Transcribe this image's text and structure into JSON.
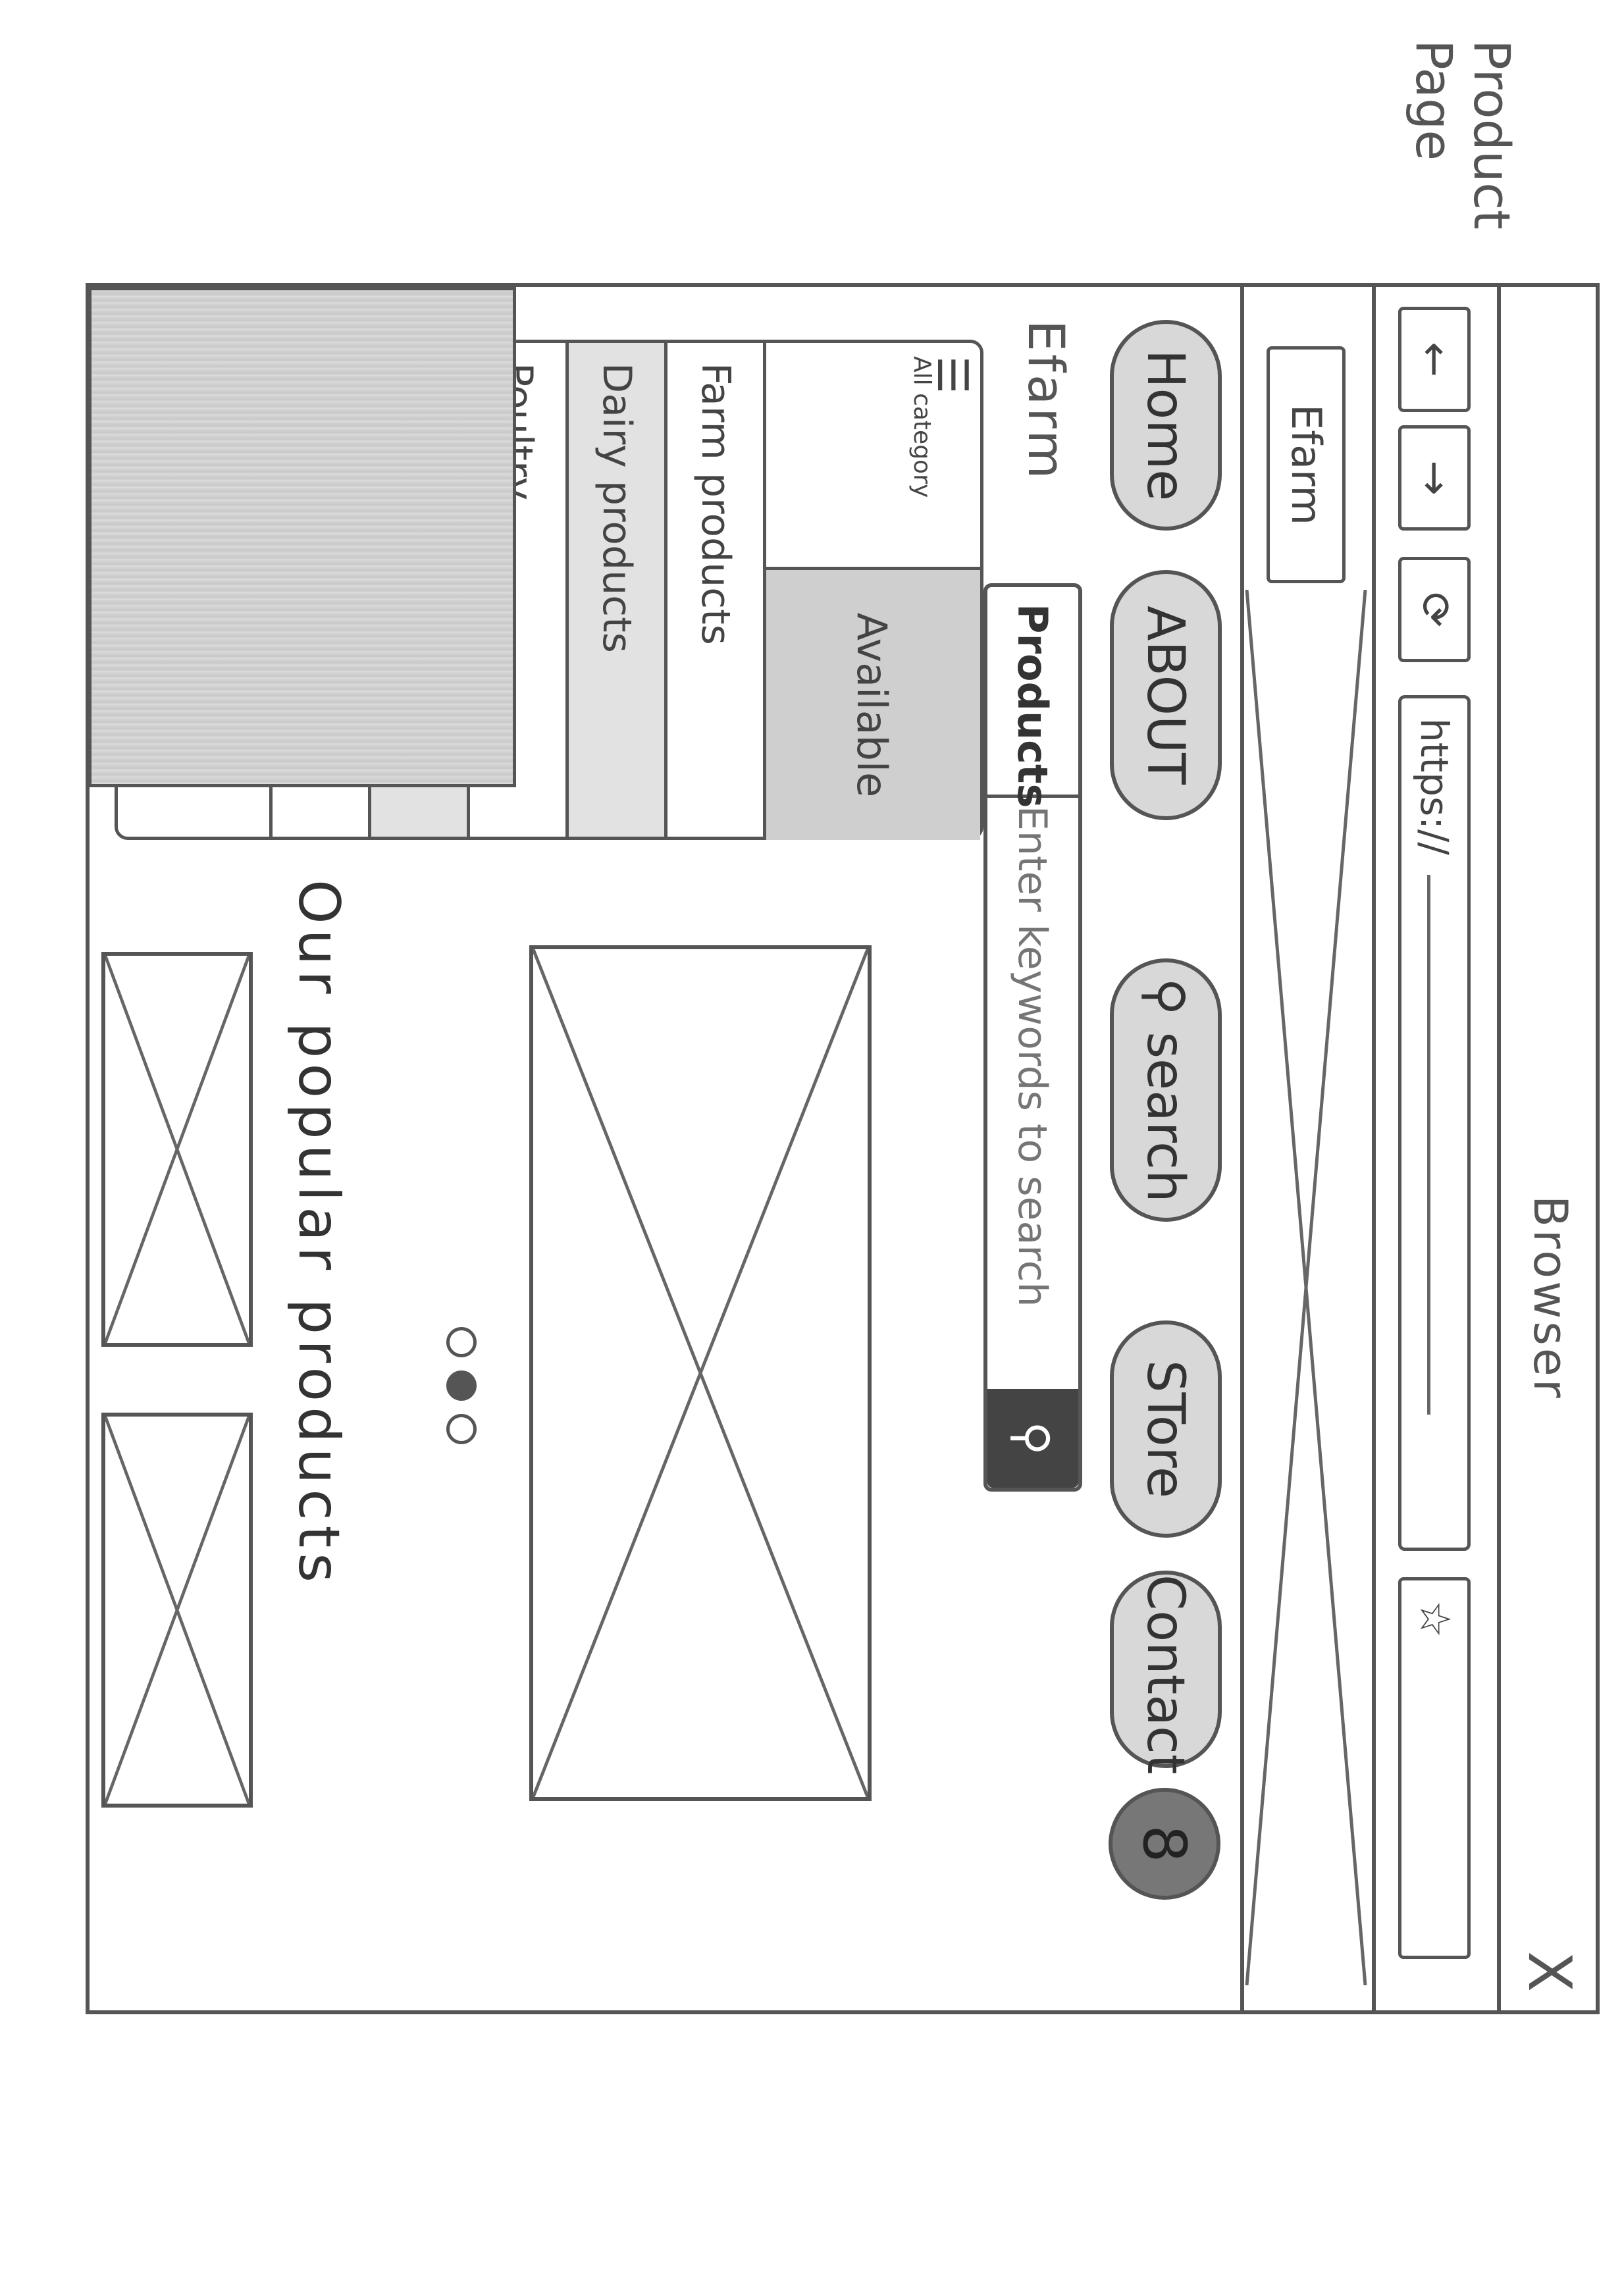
{
  "annotation": {
    "page_label": "Product\nPage"
  },
  "browser": {
    "title": "Browser",
    "close": "X",
    "back": "←",
    "forward": "→",
    "reload": "⟳",
    "url": "https://",
    "bookmark": "☆",
    "tab_label": "Efarm"
  },
  "nav": {
    "items": [
      {
        "label": "Home"
      },
      {
        "label": "ABOUT"
      },
      {
        "label": "search",
        "icon": "search-icon"
      },
      {
        "label": "STore"
      },
      {
        "label": "Contact"
      }
    ],
    "account_glyph": "8"
  },
  "header": {
    "logo": "Efarm",
    "search": {
      "category": "Products ∨",
      "placeholder": "Enter keywords to search",
      "button_icon": "search-icon"
    }
  },
  "category_menu": {
    "all_label": "All category",
    "available_label": "Available",
    "items": [
      "Farm products",
      "Dairy products",
      "Poultry"
    ]
  },
  "carousel": {
    "active_index": 1,
    "count": 3
  },
  "popular": {
    "title": "Our popular products",
    "count": 3
  }
}
